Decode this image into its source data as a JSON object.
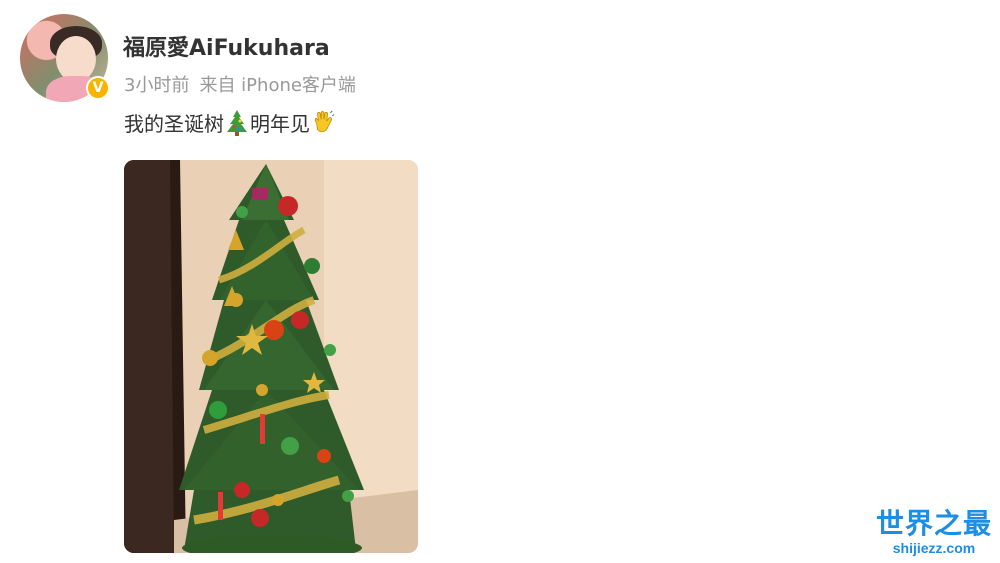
{
  "post": {
    "username": "福原愛AiFukuhara",
    "time": "3小时前",
    "source": "来自 iPhone客户端",
    "text_part1": "我的圣诞树",
    "text_part2": "明年见",
    "emoji_1": "christmas-tree",
    "emoji_2": "waving-hand"
  },
  "avatar": {
    "badge": "V",
    "badge_color": "#f7b500"
  },
  "watermark": {
    "title": "世界之最",
    "url": "shijiezz.com",
    "color": "#1d8ee6"
  }
}
